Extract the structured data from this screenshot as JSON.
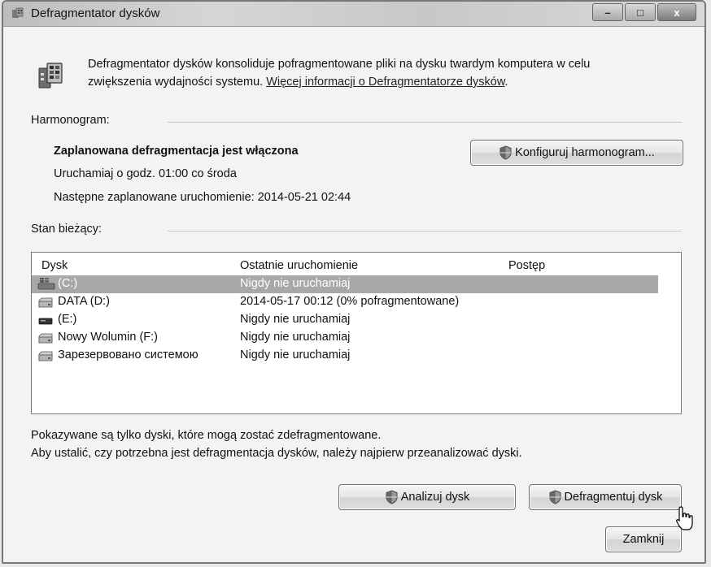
{
  "window": {
    "title": "Defragmentator dysków",
    "controls": {
      "minimize": "–",
      "maximize": "□",
      "close": "x"
    }
  },
  "intro": {
    "text_line1": "Defragmentator dysków konsoliduje pofragmentowane pliki na dysku twardym komputera w celu",
    "text_line2_prefix": "zwiększenia wydajności systemu. ",
    "link": "Więcej informacji o Defragmentatorze dysków",
    "text_line2_suffix": "."
  },
  "schedule": {
    "section_label": "Harmonogram:",
    "status": "Zaplanowana defragmentacja jest włączona",
    "run_at": "Uruchamiaj o godz. 01:00 co środa",
    "next_run": "Następne zaplanowane uruchomienie: 2014-05-21 02:44",
    "configure_button": "Konfiguruj harmonogram..."
  },
  "current_status": {
    "section_label": "Stan bieżący:",
    "columns": [
      "Dysk",
      "Ostatnie uruchomienie",
      "Postęp"
    ],
    "disks": [
      {
        "name": "(C:)",
        "last_run": "Nigdy nie uruchamiaj",
        "progress": "",
        "icon": "system-drive-icon",
        "selected": true
      },
      {
        "name": "DATA (D:)",
        "last_run": "2014-05-17 00:12 (0% pofragmentowane)",
        "progress": "",
        "icon": "hard-drive-icon",
        "selected": false
      },
      {
        "name": "(E:)",
        "last_run": "Nigdy nie uruchamiaj",
        "progress": "",
        "icon": "removable-drive-icon",
        "selected": false
      },
      {
        "name": "Nowy Wolumin  (F:)",
        "last_run": "Nigdy nie uruchamiaj",
        "progress": "",
        "icon": "hard-drive-icon",
        "selected": false
      },
      {
        "name": "Зарезервовано системою",
        "last_run": "Nigdy nie uruchamiaj",
        "progress": "",
        "icon": "hard-drive-icon",
        "selected": false
      }
    ]
  },
  "notes": {
    "line1": "Pokazywane są tylko dyski, które mogą zostać zdefragmentowane.",
    "line2": "Aby ustalić, czy potrzebna jest defragmentacja dysków, należy najpierw przeanalizować dyski."
  },
  "actions": {
    "analyze": "Analizuj dysk",
    "defragment": "Defragmentuj dysk",
    "close": "Zamknij"
  }
}
